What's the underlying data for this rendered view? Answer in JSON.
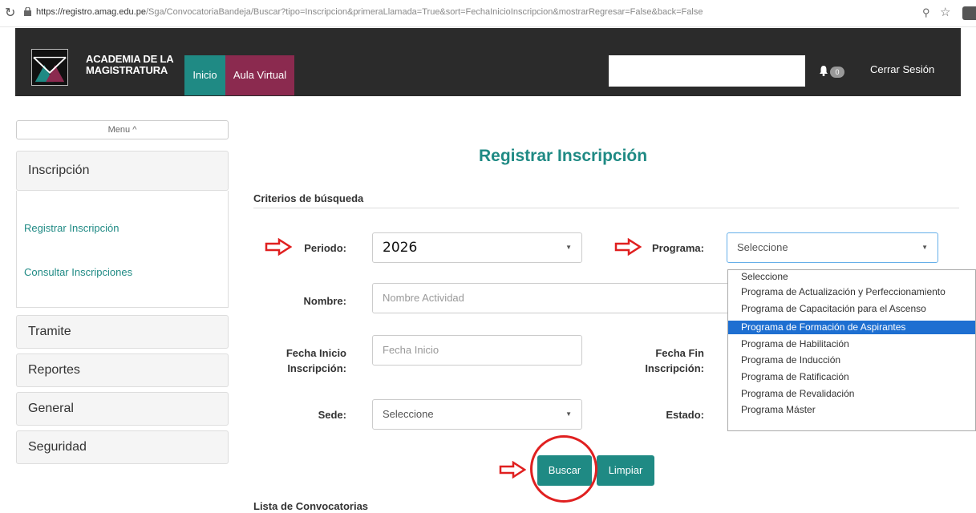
{
  "browser": {
    "url_host": "https://registro.amag.edu.pe",
    "url_path": "/Sga/ConvocatoriaBandeja/Buscar?tipo=Inscripcion&primeraLlamada=True&sort=FechaInicioInscripcion&mostrarRegresar=False&back=False"
  },
  "header": {
    "brand_line1": "ACADEMIA DE LA",
    "brand_line2": "MAGISTRATURA",
    "nav_inicio": "Inicio",
    "nav_aula": "Aula Virtual",
    "notification_count": "0",
    "logout": "Cerrar Sesión"
  },
  "sidebar": {
    "menu_toggle": "Menu",
    "panels": {
      "inscripcion": "Inscripción",
      "tramite": "Tramite",
      "reportes": "Reportes",
      "general": "General",
      "seguridad": "Seguridad"
    },
    "links": {
      "registrar": "Registrar Inscripción",
      "consultar": "Consultar Inscripciones"
    }
  },
  "main": {
    "title": "Registrar Inscripción",
    "criteria_heading": "Criterios de búsqueda",
    "labels": {
      "periodo": "Periodo:",
      "programa": "Programa:",
      "nombre": "Nombre:",
      "fecha_inicio_1": "Fecha Inicio",
      "fecha_inicio_2": "Inscripción:",
      "fecha_fin_1": "Fecha Fin",
      "fecha_fin_2": "Inscripción:",
      "sede": "Sede:",
      "estado": "Estado:"
    },
    "fields": {
      "periodo_value": "2026",
      "programa_value": "Seleccione",
      "nombre_placeholder": "Nombre Actividad",
      "fecha_inicio_placeholder": "Fecha Inicio",
      "sede_value": "Seleccione"
    },
    "programa_options": [
      "Seleccione",
      "Programa de Actualización y Perfeccionamiento",
      "Programa de Capacitación para el Ascenso",
      "Programa de Formación de Aspirantes",
      "Programa de Habilitación",
      "Programa de Inducción",
      "Programa de Ratificación",
      "Programa de Revalidación",
      "Programa Máster"
    ],
    "selected_option": "Programa de Formación de Aspirantes",
    "buttons": {
      "buscar": "Buscar",
      "limpiar": "Limpiar"
    },
    "list_heading": "Lista de Convocatorias"
  },
  "colors": {
    "teal": "#1f8a84",
    "wine": "#8b2a4f",
    "header_bg": "#2b2b2b",
    "annotation_red": "#e02020",
    "selection_blue": "#1e6fd1"
  }
}
